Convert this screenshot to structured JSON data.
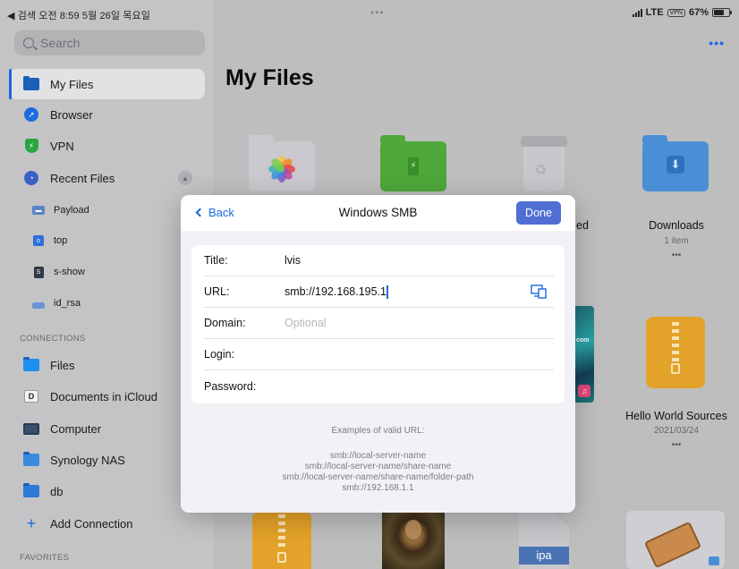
{
  "status_bar": {
    "left_text": "◀ 검색  오전 8:59  5월 26일 목요일",
    "center_dots": "•••",
    "carrier": "LTE",
    "vpn": "VPN",
    "battery_text": "67%",
    "battery_level": 0.67
  },
  "sidebar": {
    "search_placeholder": "Search",
    "items": [
      {
        "label": "My Files",
        "icon": "folder-icon",
        "selected": true
      },
      {
        "label": "Browser",
        "icon": "compass-icon"
      },
      {
        "label": "VPN",
        "icon": "shield-icon"
      },
      {
        "label": "Recent Files",
        "icon": "clock-icon"
      }
    ],
    "recent": [
      {
        "label": "Payload",
        "icon": "drive-icon"
      },
      {
        "label": "top",
        "icon": "file-icon"
      },
      {
        "label": "s-show",
        "icon": "doc-icon"
      },
      {
        "label": "id_rsa",
        "icon": "drive-icon"
      }
    ],
    "connections_header": "CONNECTIONS",
    "connections": [
      {
        "label": "Files",
        "icon": "files-icon"
      },
      {
        "label": "Documents in iCloud",
        "icon": "documents-icon"
      },
      {
        "label": "Computer",
        "icon": "computer-icon"
      },
      {
        "label": "Synology NAS",
        "icon": "nas-icon"
      },
      {
        "label": "db",
        "icon": "server-icon"
      },
      {
        "label": "Add Connection",
        "icon": "plus-icon"
      }
    ],
    "favorites_header": "FAVORITES"
  },
  "main": {
    "title": "My Files",
    "more_dots": "•••",
    "folders": [
      {
        "name": "Downloads",
        "meta": "1 item",
        "dots": "•••"
      },
      {
        "name": "Hello World Sources",
        "meta": "2021/03/24",
        "dots": "•••"
      }
    ],
    "partial_label": "ed",
    "ipa_label": "ipa",
    "media_label": "com"
  },
  "modal": {
    "back_label": "Back",
    "title": "Windows SMB",
    "done_label": "Done",
    "fields": {
      "title_label": "Title:",
      "title_value": "lvis",
      "url_label": "URL:",
      "url_value": "smb://192.168.195.1",
      "domain_label": "Domain:",
      "domain_placeholder": "Optional",
      "login_label": "Login:",
      "password_label": "Password:"
    },
    "examples_header": "Examples of valid URL:",
    "examples": [
      "smb://local-server-name",
      "smb://local-server-name/share-name",
      "smb://local-server-name/share-name/folder-path",
      "smb://192.168.1.1"
    ]
  },
  "colors": {
    "accent": "#1b6ae0",
    "done_button": "#4f6fd3",
    "vpn_green": "#2aa641",
    "zip_orange": "#e3a229",
    "green_folder": "#4fa83a",
    "blue_folder": "#4a8fd6"
  }
}
